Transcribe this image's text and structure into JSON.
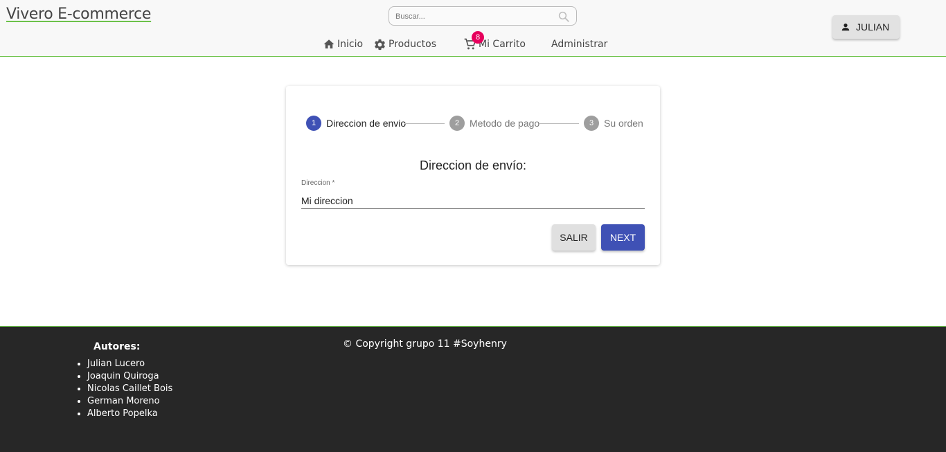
{
  "header": {
    "brand": "Vivero E-commerce",
    "search_placeholder": "Buscar...",
    "nav": {
      "inicio": "Inicio",
      "productos": "Productos",
      "carrito": "Mi Carrito",
      "cart_count": "8",
      "administrar": "Administrar"
    },
    "user_label": "JULIAN",
    "accent_color": "#6cc24a"
  },
  "stepper": {
    "steps": [
      {
        "number": "1",
        "label": "Direccion de envio",
        "state": "active"
      },
      {
        "number": "2",
        "label": "Metodo de pago",
        "state": "inactive"
      },
      {
        "number": "3",
        "label": "Su orden",
        "state": "inactive"
      }
    ],
    "active_color": "#3f51b5",
    "inactive_color": "#9e9e9e"
  },
  "form": {
    "title": "Direccion de envío:",
    "address_label": "Direccion *",
    "address_value": "Mi direccion",
    "salir_label": "SALIR",
    "next_label": "NEXT"
  },
  "footer": {
    "authors_title": "Autores:",
    "authors": [
      "Julian Lucero",
      "Joaquin Quiroga",
      "Nicolas Caillet Bois",
      "German Moreno",
      "Alberto Popelka"
    ],
    "copyright": "© Copyright grupo 11 #Soyhenry"
  }
}
